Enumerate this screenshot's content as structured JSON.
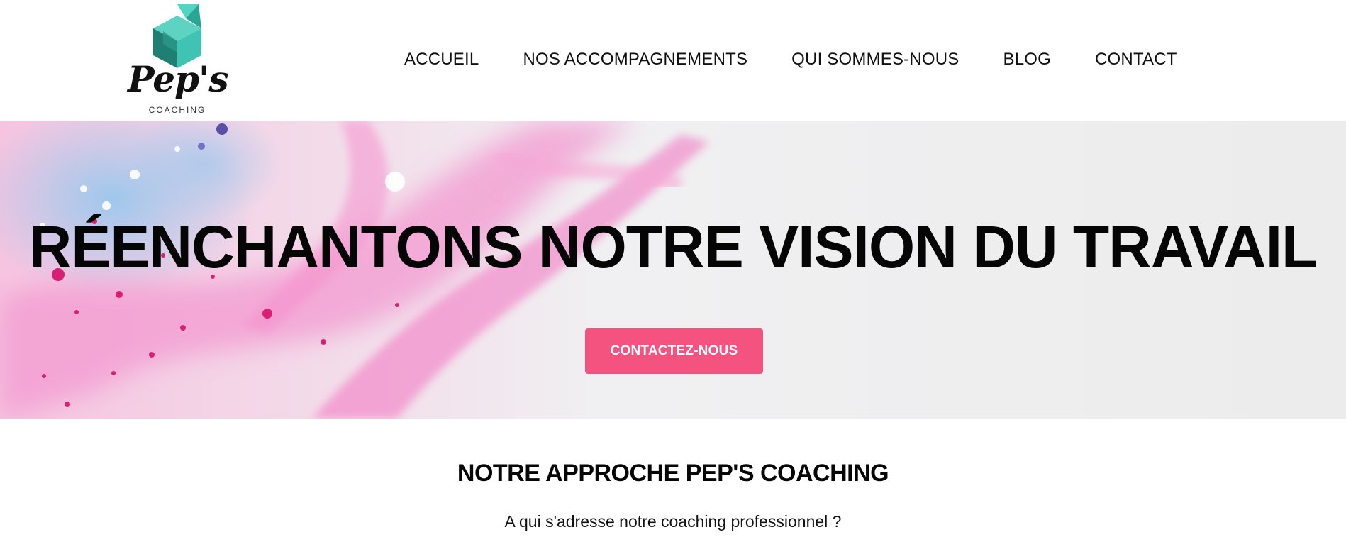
{
  "logo": {
    "name": "Pep's",
    "tagline": "COACHING"
  },
  "nav": {
    "items": [
      {
        "label": "ACCUEIL"
      },
      {
        "label": "NOS ACCOMPAGNEMENTS"
      },
      {
        "label": "QUI SOMMES-NOUS"
      },
      {
        "label": "BLOG"
      },
      {
        "label": "CONTACT"
      }
    ]
  },
  "hero": {
    "title": "RÉENCHANTONS NOTRE VISION DU TRAVAIL",
    "button_label": "CONTACTEZ-NOUS"
  },
  "section": {
    "title": "NOTRE APPROCHE PEP'S COACHING",
    "subtitle": "A qui s'adresse notre coaching professionnel ?"
  },
  "colors": {
    "accent": "#f5537f",
    "logo_teal": "#3fc4b3",
    "logo_dark": "#1f7f72"
  }
}
